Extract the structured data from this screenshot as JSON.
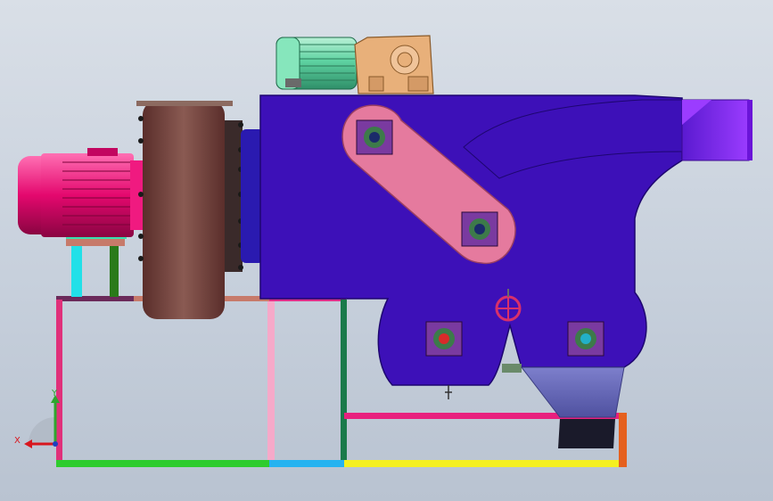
{
  "viewport": {
    "background_top": "#d9dfe7",
    "background_bottom": "#b9c3d1"
  },
  "triad": {
    "x_label": "X",
    "y_label": "Y",
    "x_color": "#d8161e",
    "y_color": "#2ea62e",
    "z_color": "#1f3fbf"
  },
  "colors": {
    "housing": "#3d10b8",
    "crank_arm": "#e57a9e",
    "fan_disc": "#7a4a45",
    "fan_motor": "#e4086e",
    "gear_motor": "#5fd3a2",
    "gearbox": "#e8b07a",
    "hopper": "#6a6cba",
    "outlet_duct": "#7a1fe0"
  }
}
